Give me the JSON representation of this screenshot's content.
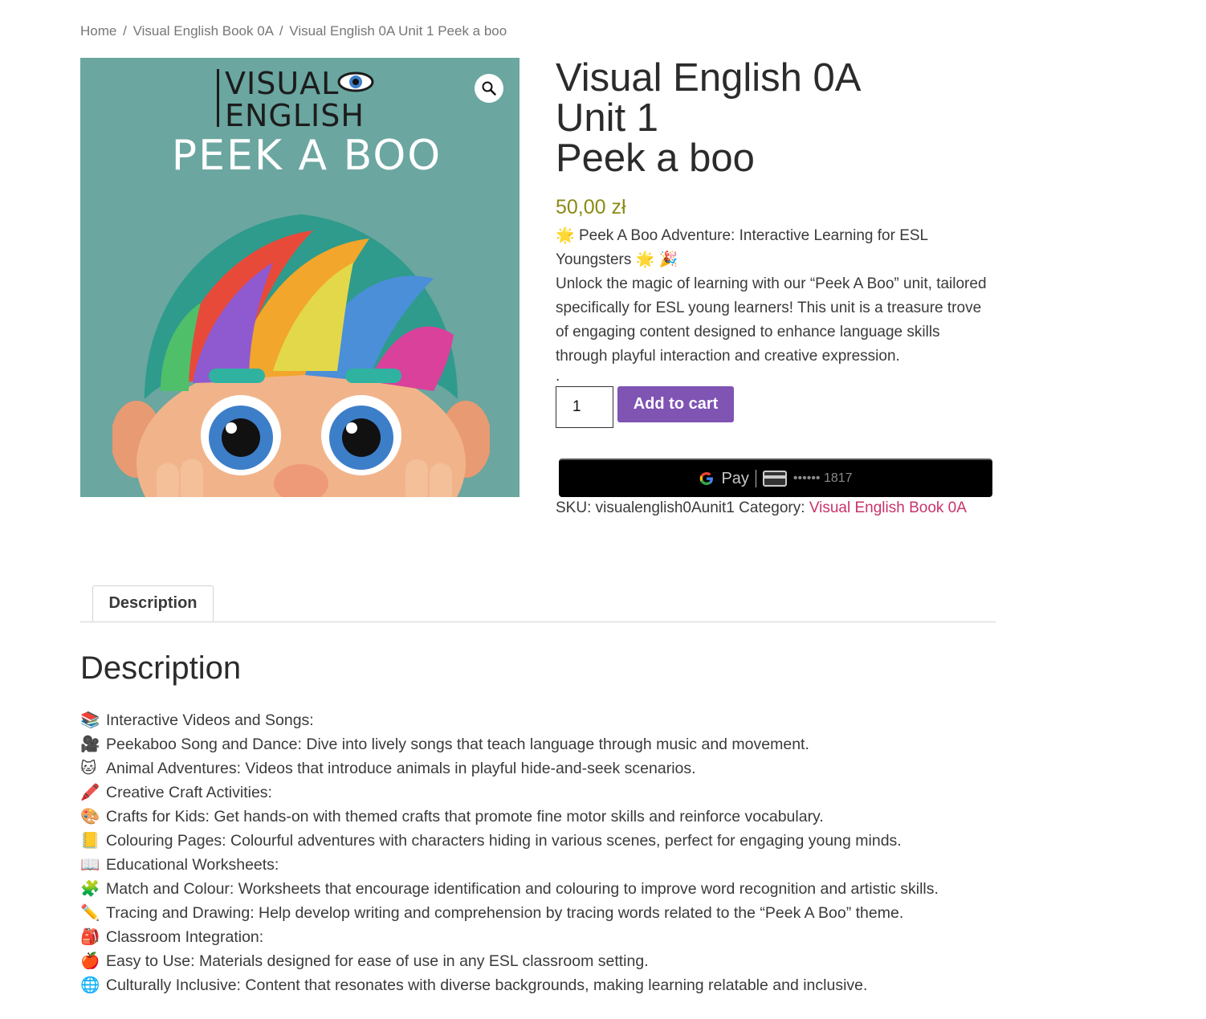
{
  "breadcrumb": {
    "home": "Home",
    "separator": "/",
    "category": "Visual English Book 0A",
    "current": "Visual English 0A Unit 1 Peek a boo"
  },
  "gallery": {
    "zoom_icon": "magnifier-icon",
    "cover_brand_line1": "VISUAL",
    "cover_brand_line2": "ENGLISH",
    "cover_title": "PEEK A BOO",
    "background": "#6ba6a0"
  },
  "product": {
    "title_line1": "Visual English 0A",
    "title_line2": "Unit 1",
    "title_line3": "Peek a boo",
    "price": "50,00 zł",
    "short_heading": "Peek A Boo Adventure: Interactive Learning for ESL Youngsters",
    "short_body": "Unlock the magic of learning with our “Peek A Boo” unit, tailored specifically for ESL young learners! This unit is a treasure trove of engaging content designed to enhance language skills through playful interaction and creative expression.",
    "dot": ".",
    "quantity": "1",
    "add_to_cart": "Add to cart",
    "gpay_label": "Pay",
    "gpay_card_digits": "•••••• 1817",
    "sku_label": "SKU:",
    "sku": "visualenglish0Aunit1",
    "category_label": "Category:",
    "category": "Visual English Book 0A"
  },
  "tabs": [
    {
      "label": "Description"
    }
  ],
  "description": {
    "heading": "Description",
    "items": [
      {
        "icon": "books-icon",
        "text": "Interactive Videos and Songs:"
      },
      {
        "icon": "video-camera-icon",
        "text": "Peekaboo Song and Dance: Dive into lively songs that teach language through music and movement."
      },
      {
        "icon": "cat-face-icon",
        "text": "Animal Adventures: Videos that introduce animals in playful hide-and-seek scenarios."
      },
      {
        "icon": "crayon-icon",
        "text": "Creative Craft Activities:"
      },
      {
        "icon": "palette-icon",
        "text": "Crafts for Kids: Get hands-on with themed crafts that promote fine motor skills and reinforce vocabulary."
      },
      {
        "icon": "notebook-icon",
        "text": "Colouring Pages: Colourful adventures with characters hiding in various scenes, perfect for engaging young minds."
      },
      {
        "icon": "open-book-icon",
        "text": "Educational Worksheets:"
      },
      {
        "icon": "puzzle-piece-icon",
        "text": "Match and Colour: Worksheets that encourage identification and colouring to improve word recognition and artistic skills."
      },
      {
        "icon": "pencil-icon",
        "text": "Tracing and Drawing: Help develop writing and comprehension by tracing words related to the “Peek A Boo” theme."
      },
      {
        "icon": "backpack-icon",
        "text": "Classroom Integration:"
      },
      {
        "icon": "apple-icon",
        "text": "Easy to Use: Materials designed for ease of use in any ESL classroom setting."
      },
      {
        "icon": "globe-icon",
        "text": "Culturally Inclusive: Content that resonates with diverse backgrounds, making learning relatable and inclusive."
      }
    ]
  },
  "colors": {
    "accent": "#7f54b3",
    "price": "#8b8b14",
    "link": "#c8336a"
  }
}
